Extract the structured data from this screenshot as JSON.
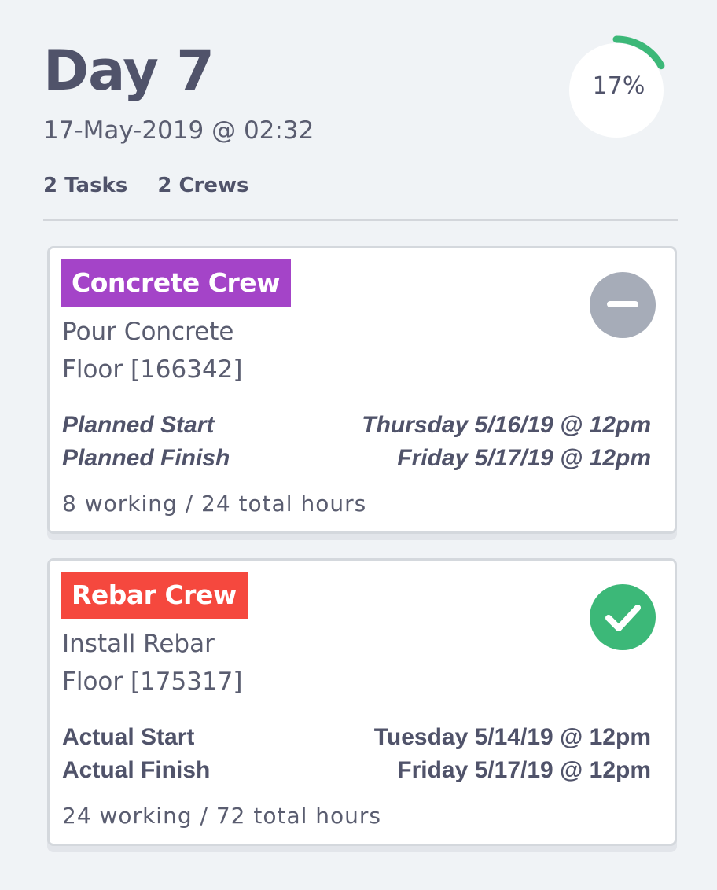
{
  "header": {
    "title": "Day 7",
    "datetime": "17-May-2019 @ 02:32",
    "tasks_count": "2 Tasks",
    "crews_count": "2 Crews",
    "progress_label": "17%",
    "progress_fraction": 0.17,
    "progress_color": "#3cb878"
  },
  "tasks": [
    {
      "crew": "Concrete Crew",
      "crew_color": "#a444c8",
      "name": "Pour Concrete",
      "location": "Floor [166342]",
      "start_label": "Planned Start",
      "start_value": "Thursday 5/16/19 @ 12pm",
      "finish_label": "Planned Finish",
      "finish_value": "Friday 5/17/19 @ 12pm",
      "hours": "8 working / 24 total hours",
      "status_icon": "minus-circle-icon",
      "status_color": "#a6acb8"
    },
    {
      "crew": "Rebar Crew",
      "crew_color": "#f5483e",
      "name": "Install Rebar",
      "location": "Floor [175317]",
      "start_label": "Actual Start",
      "start_value": "Tuesday 5/14/19 @ 12pm",
      "finish_label": "Actual Finish",
      "finish_value": "Friday 5/17/19 @ 12pm",
      "hours": "24 working / 72 total hours",
      "status_icon": "check-circle-icon",
      "status_color": "#3cb878"
    }
  ]
}
